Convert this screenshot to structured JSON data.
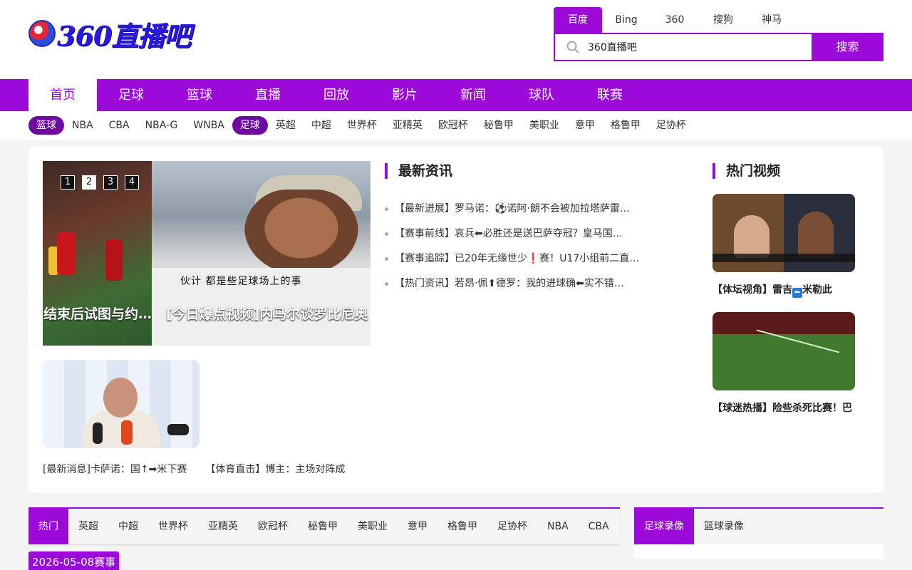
{
  "brand": {
    "logo_text": "360直播吧",
    "accent_color": "#9b0ad8"
  },
  "search": {
    "engines": [
      "百度",
      "Bing",
      "360",
      "搜狗",
      "神马"
    ],
    "active_engine_index": 0,
    "query": "360直播吧",
    "button_label": "搜索"
  },
  "main_nav": [
    "首页",
    "足球",
    "篮球",
    "直播",
    "回放",
    "影片",
    "新闻",
    "球队",
    "联赛"
  ],
  "sub_nav": {
    "basketball_label": "篮球",
    "basketball_items": [
      "NBA",
      "CBA",
      "NBA-G",
      "WNBA"
    ],
    "football_label": "足球",
    "football_items": [
      "英超",
      "中超",
      "世界杯",
      "亚精英",
      "欧冠杯",
      "秘鲁甲",
      "美职业",
      "意甲",
      "格鲁甲",
      "足协杯"
    ]
  },
  "slider": {
    "dots": [
      "1",
      "2",
      "3",
      "4"
    ],
    "active_dot_index": 1,
    "caption_left": "结束后试图与约…",
    "caption_right": "[今日爆点视频]内马尔谈罗比尼奥",
    "subtitle_text": "伙计 都是些足球场上的事"
  },
  "below_links": [
    "[最新消息]卡萨诺：国↑➡米下赛",
    "【体育直击】博主：主场对阵成"
  ],
  "latest_news": {
    "title": "最新资讯",
    "items": [
      "【最新进展】罗马诺：⚽诺阿·朗不会被加拉塔萨雷…",
      "【赛事前线】哀兵⬅必胜还是送巴萨夺冠？皇马国…",
      "【赛事追踪】已20年无缘世少❗赛！U17小组前二直…",
      "【热门资讯】若昂·佩⬆德罗：我的进球确⬅实不错…"
    ]
  },
  "hot_videos": {
    "title": "热门视频",
    "items": [
      {
        "title_a": "【体坛视角】雷吉",
        "title_b": "米勒此"
      },
      {
        "title_a": "【球迷热播】险些杀死比赛！巴",
        "title_b": ""
      }
    ]
  },
  "bottom_tabs": [
    "热门",
    "英超",
    "中超",
    "世界杯",
    "亚精英",
    "欧冠杯",
    "秘鲁甲",
    "美职业",
    "意甲",
    "格鲁甲",
    "足协杯",
    "NBA",
    "CBA"
  ],
  "right_tabs": [
    "足球录像",
    "篮球录像"
  ],
  "date_badge": "2026-05-08赛事"
}
